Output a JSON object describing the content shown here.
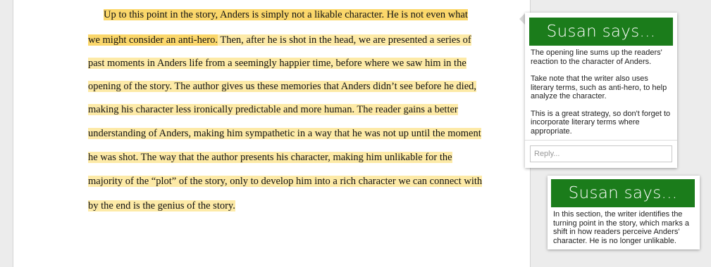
{
  "document": {
    "lines": [
      "Up to this point in the story, Anders is simply not a likable character. He is not even what",
      "we might consider an anti-hero.",
      " Then, after he is shot in the head, we are presented a series of",
      "past moments in Anders life from a seemingly happier time, before where we saw him in the",
      "opening of the story. The author gives us these memories that Anders didn’t see before he died,",
      "making his character less ironically predictable and more human. The reader gains a better",
      "understanding of Anders, making him sympathetic in a way that he was not up until the moment",
      "he was shot. The way that the author presents his character, making him unlikable for the",
      "majority of the “plot” of the story, only to develop him into a rich character we can connect with",
      "by the end is the genius of the story."
    ]
  },
  "comments": [
    {
      "banner": "Susan says...",
      "paragraphs": [
        "The opening line sums up the readers' reaction to the character of Anders.",
        "Take note that the writer also uses literary terms, such as anti-hero, to help analyze the character.",
        "This is a great strategy, so don't forget to incorporate literary terms where appropriate."
      ],
      "reply_placeholder": "Reply..."
    },
    {
      "banner": "Susan says...",
      "paragraphs": [
        "In this section, the writer identifies the turning point in the story, which marks a shift in how readers perceive Anders' character. He is no longer unlikable."
      ]
    }
  ],
  "colors": {
    "highlight_light": "#fdeaa7",
    "highlight_strong": "#fbd76b",
    "banner_green": "#1b7c1b"
  }
}
